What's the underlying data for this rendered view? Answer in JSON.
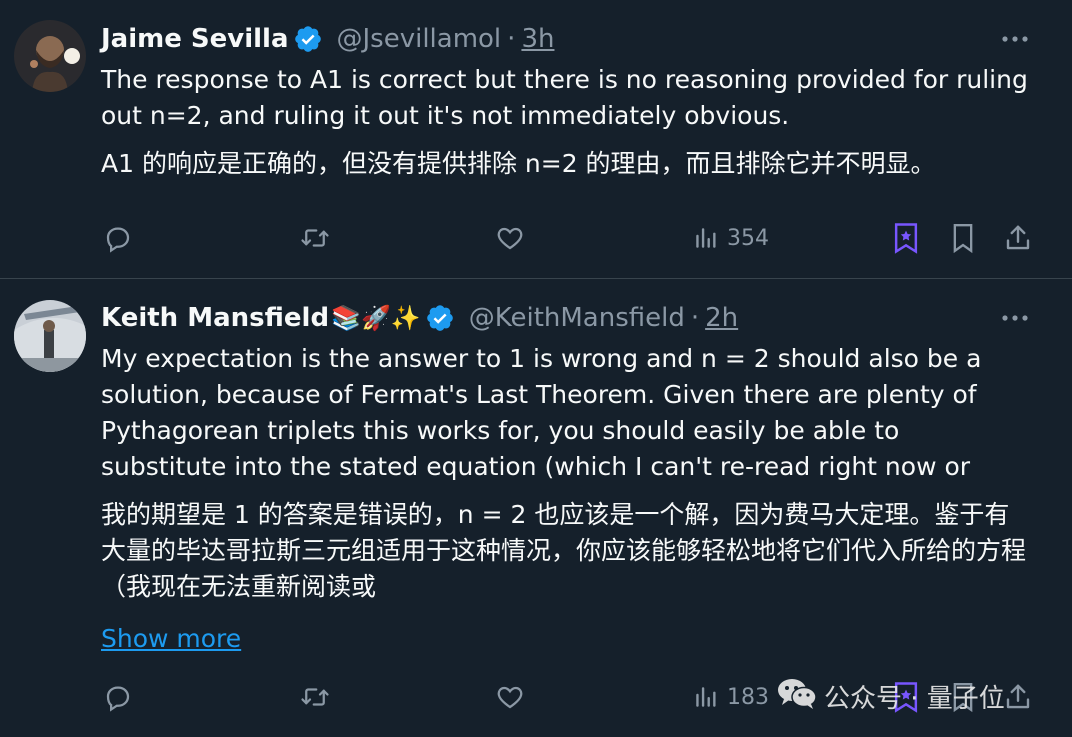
{
  "colors": {
    "background": "#15202b",
    "text": "#f7f9f9",
    "muted": "#8b98a5",
    "link": "#1d9bf0",
    "verified": "#1d9bf0",
    "bookmark_active": "#7856ff",
    "divider": "#38444d"
  },
  "tweets": [
    {
      "name": "Jaime Sevilla",
      "handle": "@Jsevillamol",
      "dot": "·",
      "time": "3h",
      "text": "The response to A1 is correct but there is no reasoning provided for ruling out n=2, and ruling it out it's not immediately obvious.",
      "translation": "A1 的响应是正确的，但没有提供排除 n=2 的理由，而且排除它并不明显。",
      "views": "354",
      "icons": [
        "reply-icon",
        "retweet-icon",
        "like-icon",
        "views-icon",
        "grok-bookmark-icon",
        "bookmark-icon",
        "share-icon"
      ]
    },
    {
      "name": "Keith Mansfield",
      "emojis": "📚🚀✨",
      "handle": "@KeithMansfield",
      "dot": "·",
      "time": "2h",
      "text": "My expectation is the answer to 1 is wrong and n = 2 should also be a solution, because of Fermat's Last Theorem. Given there are plenty of Pythagorean triplets this works for, you should easily be able to substitute into the stated equation (which I can't re-read right now or",
      "translation": "我的期望是 1 的答案是错误的，n = 2 也应该是一个解，因为费马大定理。鉴于有大量的毕达哥拉斯三元组适用于这种情况，你应该能够轻松地将它们代入所给的方程（我现在无法重新阅读或",
      "show_more": "Show more",
      "views": "183"
    }
  ],
  "watermark": {
    "text": "公众号 · 量子位",
    "icon": "wechat-icon"
  }
}
